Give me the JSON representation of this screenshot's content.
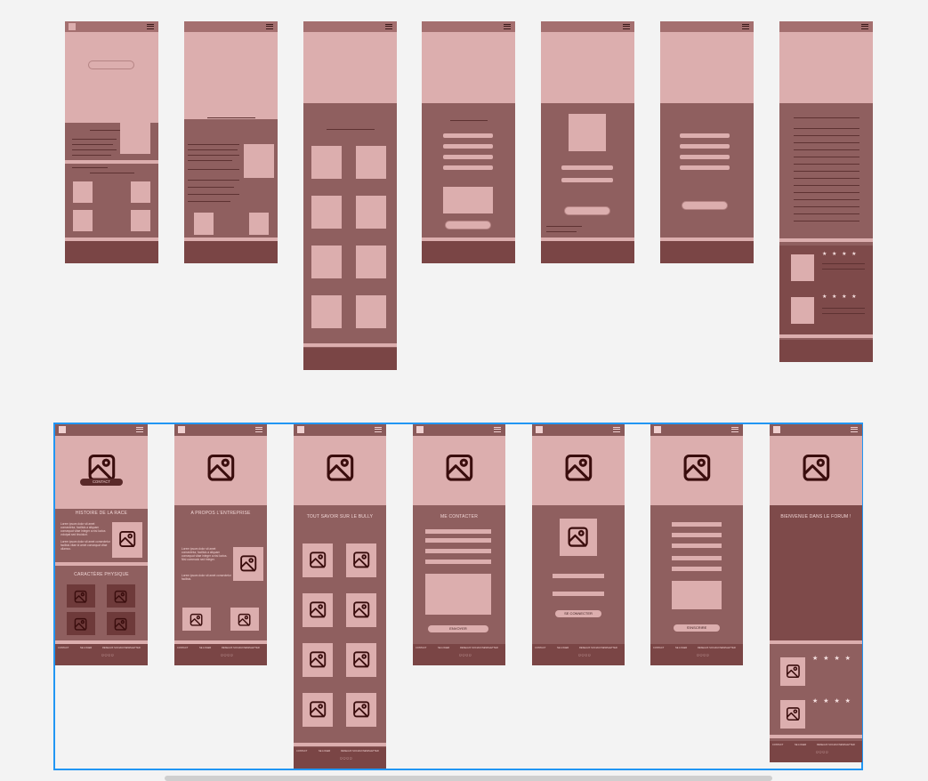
{
  "colors": {
    "rose_light": "#dcaeae",
    "rose_mid": "#8f5f5f",
    "rose_dark": "#7a4545",
    "selection": "#2196f3",
    "canvas": "#f3f3f3"
  },
  "icons": {
    "menu": "hamburger-menu-icon",
    "image": "image-placeholder-icon",
    "star": "star-icon"
  },
  "hifi": {
    "home": {
      "contact_label": "CONTACT",
      "section1_title": "HISTOIRE DE LA RACE",
      "section1_text": "Lorem ipsum dolor sit amet consectetur, facilisis a aliquam consequat vitae integer a nisi luctus volutpat sed tincidunt.",
      "section1_text2": "Lorem ipsum dolor sit amet consectetur facilisis vitae id amet consequat vitae ullamco.",
      "section2_title": "CARACTÈRE PHYSIQUE"
    },
    "about": {
      "title": "A PROPOS L'ENTREPRISE",
      "text": "Lorem ipsum dolor sit amet consectetur, facilisis a aliquam consequat vitae integer a nisi luctus. Nisl commodo sed integer.",
      "text2": "Lorem ipsum dolor sit amet consectetur facilisis."
    },
    "gallery": {
      "title": "TOUT SAVOIR SUR LE BULLY"
    },
    "contact": {
      "title": "ME CONTACTER",
      "submit": "ENVOYER"
    },
    "login": {
      "submit": "SE CONNECTER"
    },
    "signup": {
      "submit": "S'INSCRIRE"
    },
    "forum": {
      "title": "BIENVENUE DANS LE FORUM !",
      "stars": "★ ★ ★ ★"
    },
    "footer": {
      "col1": "CONTACT",
      "col2": "SE LOGER",
      "col3": "RESEAUX SOCIAUX",
      "col4": "NEWSLETTER",
      "social": "◯ ◯ ◯ ◯"
    }
  }
}
